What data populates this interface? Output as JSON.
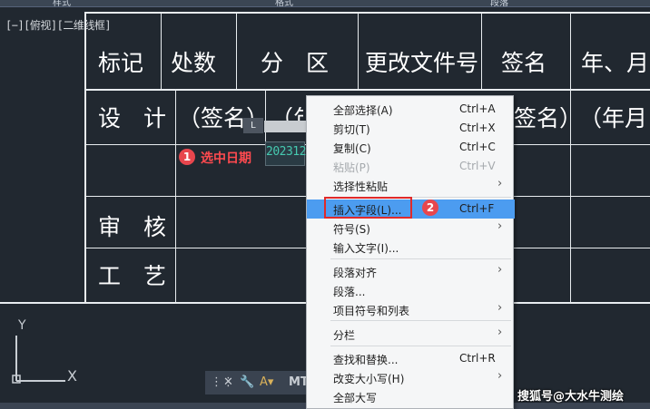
{
  "ribbon": {
    "left_label": "样式",
    "mid_label": "格式",
    "right_label": "段落"
  },
  "viewport": {
    "view_label": "[−][俯视][二维线框]"
  },
  "table": {
    "row1": [
      "标记",
      "处数",
      "分　区",
      "更改文件号",
      "签名",
      "年、月"
    ],
    "row2": [
      "设　计",
      "（签名）",
      "（年",
      "签名）",
      "（年月"
    ],
    "row4": [
      "审　核"
    ],
    "row5": [
      "工　艺"
    ]
  },
  "editor": {
    "tab_label": "L",
    "date_text": "202312"
  },
  "steps": {
    "step1_number": "1",
    "step1_label": "选中日期",
    "step2_number": "2"
  },
  "menu": {
    "items": [
      {
        "label": "全部选择(A)",
        "shortcut": "Ctrl+A",
        "arrow": ""
      },
      {
        "label": "剪切(T)",
        "shortcut": "Ctrl+X",
        "arrow": ""
      },
      {
        "label": "复制(C)",
        "shortcut": "Ctrl+C",
        "arrow": ""
      },
      {
        "label": "粘贴(P)",
        "shortcut": "Ctrl+V",
        "arrow": ""
      },
      {
        "label": "选择性粘贴",
        "shortcut": "",
        "arrow": "›"
      },
      {
        "label": "插入字段(L)...",
        "shortcut": "Ctrl+F",
        "arrow": ""
      },
      {
        "label": "符号(S)",
        "shortcut": "",
        "arrow": "›"
      },
      {
        "label": "输入文字(I)...",
        "shortcut": "",
        "arrow": ""
      },
      {
        "label": "段落对齐",
        "shortcut": "",
        "arrow": "›"
      },
      {
        "label": "段落...",
        "shortcut": "",
        "arrow": ""
      },
      {
        "label": "项目符号和列表",
        "shortcut": "",
        "arrow": "›"
      },
      {
        "label": "分栏",
        "shortcut": "",
        "arrow": "›"
      },
      {
        "label": "查找和替换...",
        "shortcut": "Ctrl+R",
        "arrow": ""
      },
      {
        "label": "改变大小写(H)",
        "shortcut": "",
        "arrow": "›"
      },
      {
        "label": "全部大写",
        "shortcut": "",
        "arrow": ""
      }
    ]
  },
  "toolbar": {
    "mt_label": "MT"
  },
  "axes": {
    "y_label": "Y",
    "x_label": "X"
  },
  "watermark": "搜狐号@大水牛测绘",
  "colors": {
    "highlight": "#4c9cf0",
    "annotation_red": "#e02a2a",
    "date_text": "#46c9b0"
  }
}
